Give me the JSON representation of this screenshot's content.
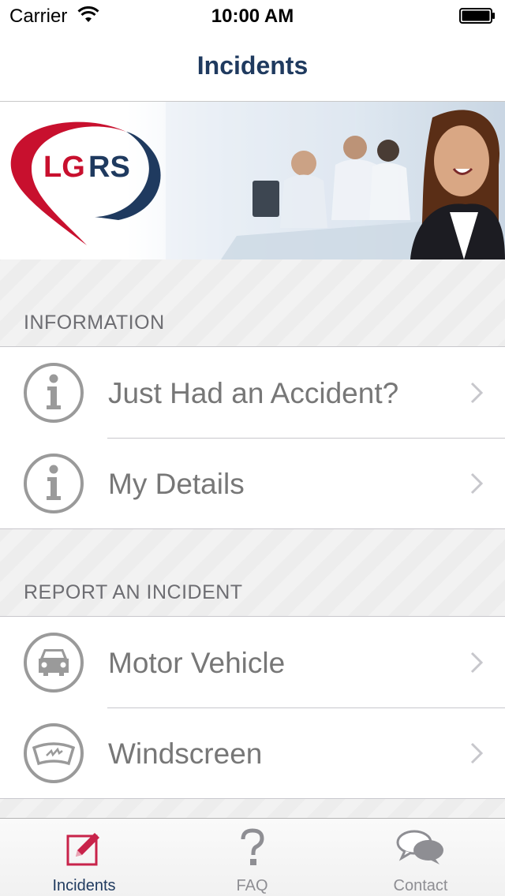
{
  "status_bar": {
    "carrier": "Carrier",
    "time": "10:00 AM"
  },
  "nav": {
    "title": "Incidents"
  },
  "banner": {
    "logo_text": "LGRS"
  },
  "sections": [
    {
      "header": "INFORMATION",
      "items": [
        {
          "label": "Just Had an Accident?",
          "icon": "info-icon"
        },
        {
          "label": "My Details",
          "icon": "info-icon"
        }
      ]
    },
    {
      "header": "REPORT AN INCIDENT",
      "items": [
        {
          "label": "Motor Vehicle",
          "icon": "car-icon"
        },
        {
          "label": "Windscreen",
          "icon": "windscreen-icon"
        }
      ]
    }
  ],
  "tab_bar": {
    "tabs": [
      {
        "label": "Incidents",
        "icon": "edit-icon",
        "active": true
      },
      {
        "label": "FAQ",
        "icon": "question-icon",
        "active": false
      },
      {
        "label": "Contact",
        "icon": "chat-bubbles-icon",
        "active": false
      }
    ]
  },
  "colors": {
    "brand_navy": "#1f3a5f",
    "brand_red": "#c8102e",
    "tab_active": "#c8234a",
    "text_gray": "#777777"
  }
}
